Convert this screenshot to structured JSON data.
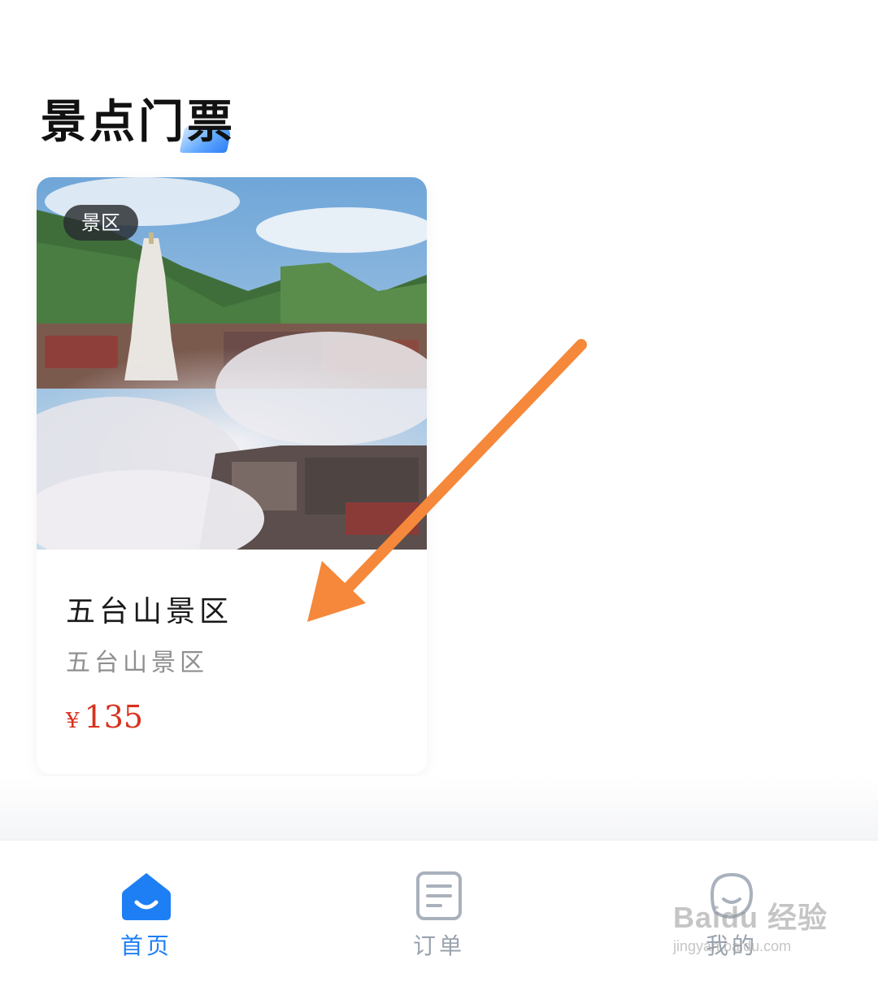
{
  "header": {
    "title": "景点门票"
  },
  "card": {
    "badge": "景区",
    "title": "五台山景区",
    "subtitle": "五台山景区",
    "currency": "¥",
    "price": "135",
    "image_alt": "scenic-photo"
  },
  "tabs": [
    {
      "label": "首页",
      "icon": "home-icon",
      "active": true
    },
    {
      "label": "订单",
      "icon": "order-icon",
      "active": false
    },
    {
      "label": "我的",
      "icon": "profile-icon",
      "active": false
    }
  ],
  "watermark": {
    "main": "Baidu 经验",
    "sub": "jingyan.baidu.com"
  },
  "colors": {
    "accent": "#1e7ff5",
    "price": "#d8321f",
    "arrow": "#f5883a",
    "inactive": "#9aa3af"
  }
}
